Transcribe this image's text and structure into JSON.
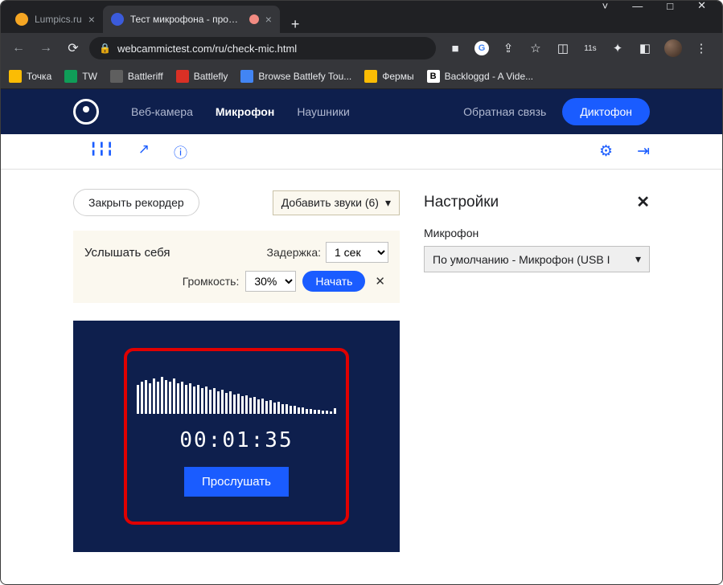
{
  "tabs": [
    {
      "title": "Lumpics.ru",
      "favicon": "#f5a623"
    },
    {
      "title": "Тест микрофона - проверка",
      "favicon": "#3b5bdb"
    }
  ],
  "url": "webcammictest.com/ru/check-mic.html",
  "bookmarks": [
    {
      "label": "Точка",
      "color": "#fbbc04"
    },
    {
      "label": "TW",
      "color": "#0f9d58"
    },
    {
      "label": "Battleriff",
      "color": "#5f5f5f"
    },
    {
      "label": "Battlefly",
      "color": "#d93025"
    },
    {
      "label": "Browse Battlefy Tou...",
      "color": "#4285f4"
    },
    {
      "label": "Фермы",
      "color": "#fbbc04"
    },
    {
      "label": "Backloggd - A Vide...",
      "color": "#202124"
    }
  ],
  "nav": {
    "webcam": "Веб-камера",
    "mic": "Микрофон",
    "headphones": "Наушники",
    "feedback": "Обратная связь",
    "dictaphone": "Диктофон"
  },
  "close_recorder": "Закрыть рекордер",
  "add_sounds": "Добавить звуки (6)",
  "hear": {
    "title": "Услышать себя",
    "delay_label": "Задержка:",
    "delay_value": "1 сек",
    "volume_label": "Громкость:",
    "volume_value": "30%",
    "start": "Начать"
  },
  "recorder": {
    "timer": "00:01:35",
    "listen": "Прослушать",
    "wave": [
      36,
      40,
      42,
      38,
      44,
      40,
      46,
      42,
      40,
      44,
      38,
      40,
      36,
      38,
      34,
      36,
      32,
      34,
      30,
      32,
      28,
      30,
      26,
      28,
      24,
      25,
      22,
      23,
      20,
      21,
      18,
      19,
      16,
      17,
      14,
      15,
      12,
      12,
      10,
      10,
      8,
      8,
      6,
      6,
      5,
      5,
      4,
      4,
      3,
      7
    ]
  },
  "settings": {
    "title": "Настройки",
    "mic_label": "Микрофон",
    "mic_value": "По умолчанию - Микрофон (USB I"
  }
}
